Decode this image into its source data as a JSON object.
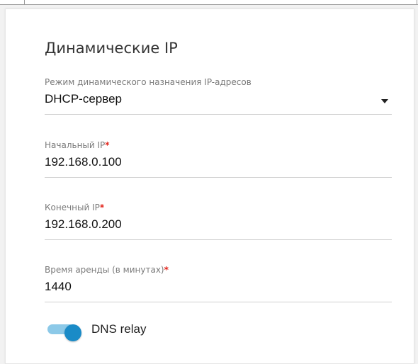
{
  "section": {
    "title": "Динамические IP"
  },
  "fields": {
    "mode": {
      "label": "Режим динамического назначения IP-адресов",
      "value": "DHCP-сервер"
    },
    "start_ip": {
      "label": "Начальный IP",
      "required_mark": "*",
      "value": "192.168.0.100"
    },
    "end_ip": {
      "label": "Конечный IP",
      "required_mark": "*",
      "value": "192.168.0.200"
    },
    "lease_time": {
      "label": "Время аренды (в минутах)",
      "required_mark": "*",
      "value": "1440"
    }
  },
  "dns_relay": {
    "label": "DNS relay",
    "enabled": true
  },
  "colors": {
    "accent": "#1a8bc7",
    "accent_track": "#8cc9e8",
    "required": "#e2231a",
    "label": "#7a7a7a",
    "underline": "#cfcfcf"
  },
  "icons": {
    "dropdown": "chevron-down-icon"
  }
}
